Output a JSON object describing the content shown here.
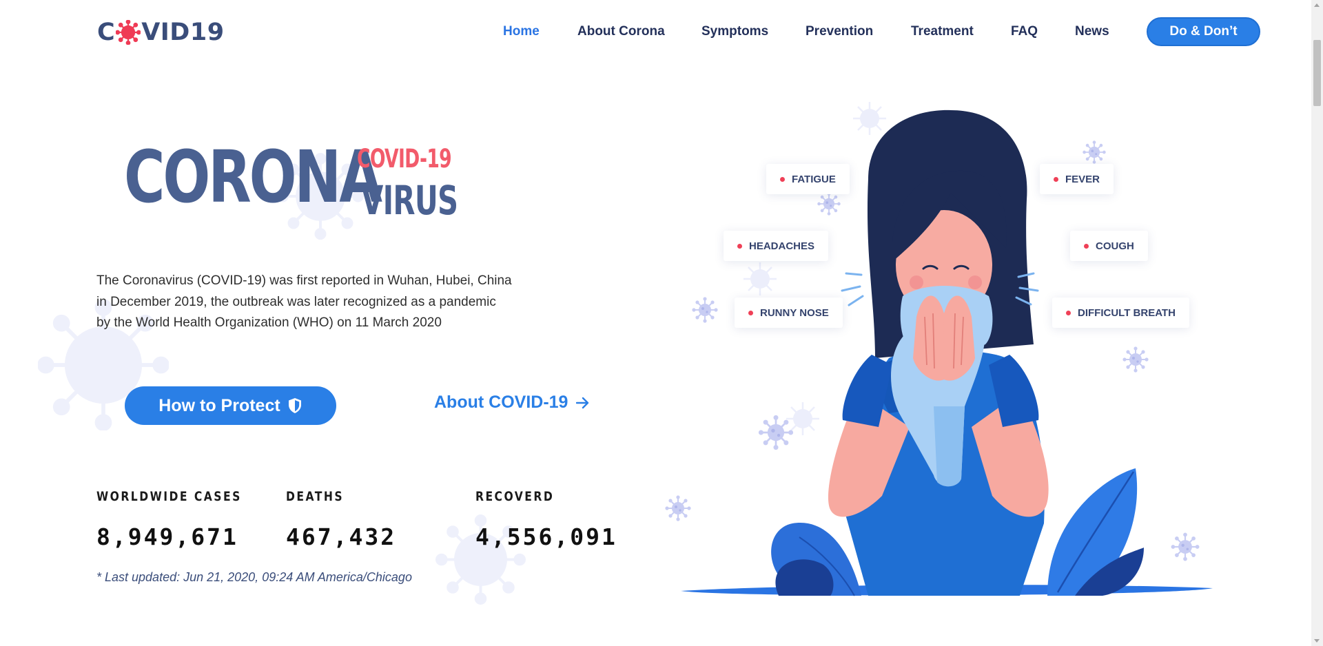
{
  "logo": {
    "text_before": "C",
    "text_after": "VID19",
    "virus_color": "#ef3b55",
    "text_color": "#3a4d7a"
  },
  "nav": {
    "items": [
      {
        "label": "Home",
        "active": true
      },
      {
        "label": "About Corona"
      },
      {
        "label": "Symptoms"
      },
      {
        "label": "Prevention"
      },
      {
        "label": "Treatment"
      },
      {
        "label": "FAQ"
      },
      {
        "label": "News"
      }
    ],
    "cta_label": "Do & Don’t"
  },
  "hero": {
    "title_main": "CORONA",
    "title_sub1": "COVID-19",
    "title_sub2": "VIRUS",
    "intro_lines": [
      "The Coronavirus (COVID-19) was first reported in Wuhan, Hubei, China",
      "in December 2019, the outbreak was later recognized as a pandemic",
      "by the World Health Organization (WHO) on 11 March 2020"
    ],
    "protect_label": "How to Protect",
    "about_label": "About COVID-19"
  },
  "stats": {
    "cases_label": "WORLDWIDE CASES",
    "cases_value": "8,949,671",
    "deaths_label": "DEATHS",
    "deaths_value": "467,432",
    "recovered_label": "RECOVERD",
    "recovered_value": "4,556,091",
    "updated": "* Last updated: Jun 21, 2020, 09:24 AM America/Chicago"
  },
  "symptoms": {
    "fatigue": "FATIGUE",
    "fever": "FEVER",
    "headaches": "HEADACHES",
    "cough": "COUGH",
    "runny_nose": "RUNNY NOSE",
    "difficult_breath": "DIFFICULT BREATH"
  },
  "colors": {
    "primary": "#2a7fe6",
    "navy": "#23305a",
    "accent_red": "#f25b6b",
    "title_blue": "#4a6191"
  }
}
